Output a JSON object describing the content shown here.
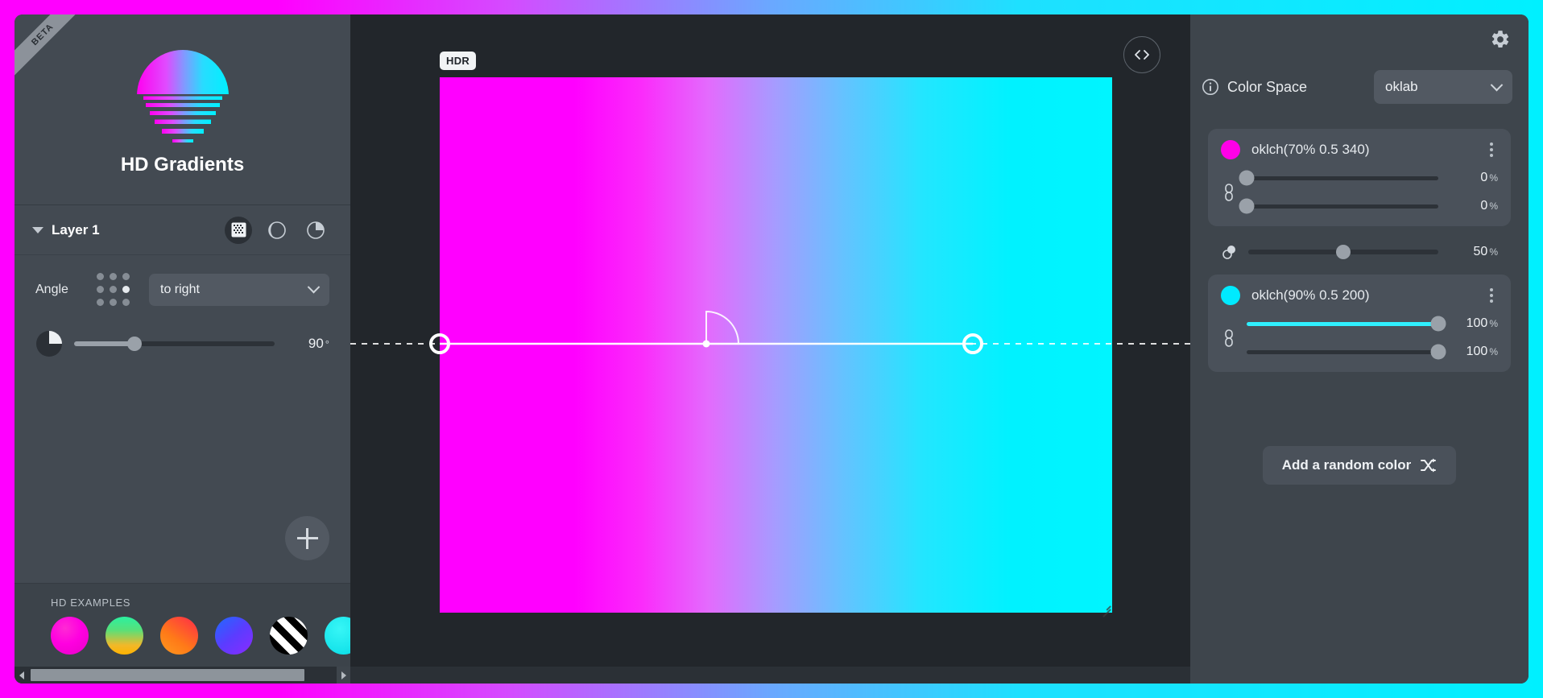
{
  "app": {
    "beta_ribbon": "BETA",
    "brand_title": "HD Gradients",
    "logo_icon": "sunset-gradient-logo"
  },
  "layer_panel": {
    "layer_name": "Layer 1",
    "collapse_icon": "chevron-down-icon",
    "icons": [
      {
        "name": "dither-icon",
        "active": true
      },
      {
        "name": "contrast-icon",
        "active": false
      },
      {
        "name": "pie-chart-icon",
        "active": false
      }
    ],
    "angle": {
      "label": "Angle",
      "preset_icon": "direction-dot-grid-icon",
      "direction_value": "to right",
      "dropdown_icon": "chevron-down-icon",
      "slider_icon": "angle-pie-icon",
      "value": "90",
      "unit": "°",
      "percent": 30
    },
    "add_layer_icon": "plus-icon"
  },
  "examples": {
    "title": "HD EXAMPLES",
    "swatches": [
      {
        "name": "example-magenta",
        "css": "radial-gradient(circle at 38% 30%, #ff2ad4 0%, #ff00e0 45%, #e800c8 100%)"
      },
      {
        "name": "example-green-orange",
        "css": "linear-gradient(180deg, #2bf0a0 0%, #58e07a 35%, #f0b82a 75%, #ffb300 100%)"
      },
      {
        "name": "example-orange-red",
        "css": "linear-gradient(35deg, #ff9a1e 0%, #ff7a18 40%, #ff2a4a 100%)"
      },
      {
        "name": "example-blue-purple",
        "css": "linear-gradient(140deg, #1f6bff 0%, #5b3cff 50%, #8a2bff 100%)"
      },
      {
        "name": "example-stripes",
        "css": "repeating-linear-gradient(45deg, #ffffff 0 9px, #000000 9px 18px)"
      },
      {
        "name": "example-cyan",
        "css": "radial-gradient(circle at 40% 32%, #37f6f6 0%, #1ae6ec 60%, #00d8e4 100%)"
      },
      {
        "name": "example-yellow",
        "css": "linear-gradient(160deg, #ffd21e 0%, #ffc400 60%, #ffae00 100%)"
      }
    ],
    "scrollbar": {
      "left_arrow": "scroll-left-arrow",
      "right_arrow": "scroll-right-arrow"
    }
  },
  "canvas": {
    "hdr_badge": "HDR",
    "code_button_label": "<>",
    "code_button_icon": "code-icon",
    "gradient_css": "linear-gradient(to right, oklch(70% 0.5 340), oklch(90% 0.5 200))",
    "handles": [
      "gradient-start-handle",
      "gradient-midpoint-handle",
      "gradient-end-handle"
    ],
    "angle_arc_icon": "angle-arc-indicator",
    "scrollbar": {
      "left_arrow": "scroll-left-arrow",
      "right_arrow": "scroll-right-arrow"
    }
  },
  "right_panel": {
    "settings_icon": "gear-icon",
    "color_space": {
      "info_icon": "info-icon",
      "label": "Color Space",
      "value": "oklab",
      "dropdown_icon": "chevron-down-icon"
    },
    "stops": [
      {
        "swatch_color": "#ff00e8",
        "label": "oklch(70% 0.5 340)",
        "menu_icon": "kebab-menu-icon",
        "link_icon": "link-icon",
        "sliders": [
          {
            "name": "position-slider",
            "value": "0",
            "unit": "%",
            "percent": 0,
            "filled": false
          },
          {
            "name": "hint-slider",
            "value": "0",
            "unit": "%",
            "percent": 0,
            "filled": false
          }
        ]
      },
      {
        "swatch_color": "#00eaff",
        "label": "oklch(90% 0.5 200)",
        "menu_icon": "kebab-menu-icon",
        "link_icon": "link-icon",
        "sliders": [
          {
            "name": "position-slider",
            "value": "100",
            "unit": "%",
            "percent": 100,
            "filled": true,
            "fill_color": "#2ff0ff"
          },
          {
            "name": "hint-slider",
            "value": "100",
            "unit": "%",
            "percent": 100,
            "filled": false
          }
        ]
      }
    ],
    "midpoint": {
      "icon": "midpoint-circles-icon",
      "value": "50",
      "unit": "%",
      "percent": 50
    },
    "random_button": {
      "label": "Add a random color",
      "icon": "shuffle-icon"
    }
  }
}
